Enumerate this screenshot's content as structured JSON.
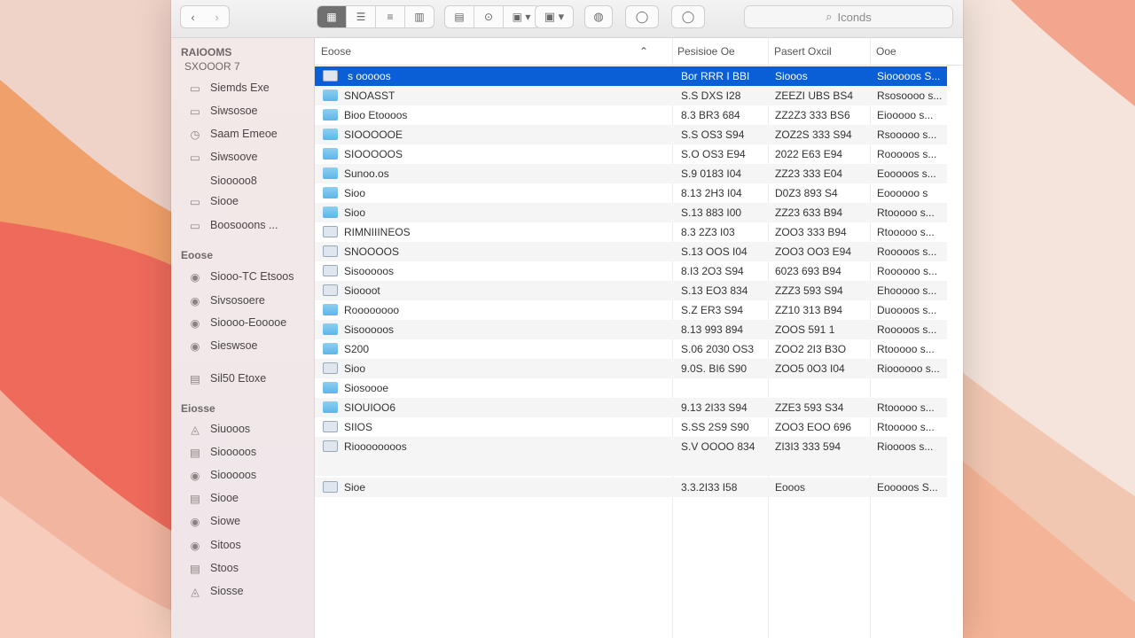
{
  "colors": {
    "accent": "#0a5fd6",
    "folder": "#5cb6e8",
    "wallpaper_orange": "#f0874e",
    "wallpaper_red": "#ee5a57"
  },
  "toolbar": {
    "search_placeholder": "Iconds",
    "icons": [
      "back-icon",
      "forward-icon",
      "grid-view-icon",
      "list-view-icon",
      "column-view-icon",
      "gallery-view-icon",
      "group-icon",
      "share-icon",
      "tag-icon",
      "action-icon",
      "airdrop-icon",
      "search-icon"
    ]
  },
  "sidebar": {
    "section1": {
      "title": "RAIOOMS",
      "subtitle": "SXOOOR 7"
    },
    "group1": [
      {
        "label": "Siemds Exe",
        "icon": "folder-icon"
      },
      {
        "label": "Siwsosoe",
        "icon": "folder-icon"
      },
      {
        "label": "Saam Emeoe",
        "icon": "clock-icon"
      },
      {
        "label": "Siwsoove",
        "icon": "folder-icon"
      },
      {
        "label": "Siooooo8",
        "icon": ""
      },
      {
        "label": "Siooe",
        "icon": "folder-icon"
      },
      {
        "label": "Boosooons ...",
        "icon": "folder-icon"
      }
    ],
    "section2": {
      "title": "Eoose"
    },
    "group2": [
      {
        "label": "Siooo-TC Etsoos",
        "icon": "disk-icon"
      },
      {
        "label": "Sivsosoere",
        "icon": "disk-icon"
      },
      {
        "label": "Sioooo-Eooooe",
        "icon": "disk-icon"
      },
      {
        "label": "Sieswsoe",
        "icon": "disk-icon"
      },
      {
        "label": "Sil50 Etoxe",
        "icon": "drive-icon"
      }
    ],
    "section3": {
      "title": "Eiosse"
    },
    "group3": [
      {
        "label": "Siuooos",
        "icon": "tag-icon"
      },
      {
        "label": "Siooooos",
        "icon": "drive-icon"
      },
      {
        "label": "Siooooos",
        "icon": "disk-icon"
      },
      {
        "label": "Siooe",
        "icon": "drive-icon"
      },
      {
        "label": "Siowe",
        "icon": "disk-icon"
      },
      {
        "label": "Sitoos",
        "icon": "disk-icon"
      },
      {
        "label": "Stoos",
        "icon": "drive-icon"
      },
      {
        "label": "Siosse",
        "icon": "tag-icon"
      }
    ]
  },
  "columns": {
    "name": "Eoose",
    "sort_indicator": "⌃",
    "modified": "Pesisioe Oe",
    "size": "Pasert Oxcil",
    "kind": "Ooe"
  },
  "files": [
    {
      "name": "s ooooos",
      "modified": "Bor RRR I BBI",
      "size": "Siooos",
      "kind": "Siooooos S...",
      "type": "file",
      "selected": true
    },
    {
      "name": "SNOASST",
      "modified": "S.S DXS I28",
      "size": "ZEEZI UBS BS4",
      "kind": "Rsosoooo s...",
      "type": "folder"
    },
    {
      "name": "Bioo Etoooos",
      "modified": "8.3 BR3 684",
      "size": "ZZ2Z3 333 BS6",
      "kind": "Eiooooo s...",
      "type": "folder"
    },
    {
      "name": "SIOOOOOE",
      "modified": "S.S OS3 S94",
      "size": "ZOZ2S 333 S94",
      "kind": "Rsooooo s...",
      "type": "folder"
    },
    {
      "name": "SIOOOOOS",
      "modified": "S.O OS3 E94",
      "size": "2022 E63 E94",
      "kind": "Rooooos s...",
      "type": "folder"
    },
    {
      "name": "Sunoo.os",
      "modified": "S.9 0183 I04",
      "size": "ZZ23 333 E04",
      "kind": "Eooooos s...",
      "type": "folder"
    },
    {
      "name": "Sioo",
      "modified": "8.13 2H3 I04",
      "size": "D0Z3 893 S4",
      "kind": "Eoooooo s",
      "type": "folder"
    },
    {
      "name": "Sioo",
      "modified": "S.13 883 I00",
      "size": "ZZ23 633 B94",
      "kind": "Rtooooo s...",
      "type": "folder"
    },
    {
      "name": "RIMNIIINEOS",
      "modified": "8.3 2Z3 I03",
      "size": "ZOO3 333 B94",
      "kind": "Rtooooo s...",
      "type": "file"
    },
    {
      "name": "SNOOOOS",
      "modified": "S.13 OOS I04",
      "size": "ZOO3 OO3 E94",
      "kind": "Rooooos s...",
      "type": "file"
    },
    {
      "name": "Sisooooos",
      "modified": "8.I3 2O3 S94",
      "size": "6023 693 B94",
      "kind": "Roooooo s...",
      "type": "file"
    },
    {
      "name": "Sioooot",
      "modified": "S.13 EO3 834",
      "size": "ZZZ3 593 S94",
      "kind": "Ehooooo s...",
      "type": "file"
    },
    {
      "name": "Roooooooo",
      "modified": "S.Z ER3 S94",
      "size": "ZZ10 313 B94",
      "kind": "Duoooos s...",
      "type": "folder"
    },
    {
      "name": "Sisooooos",
      "modified": "8.13 993 894",
      "size": "ZOOS 591 1",
      "kind": "Rooooos s...",
      "type": "folder"
    },
    {
      "name": "S200",
      "modified": "S.06 2030 OS3",
      "size": "ZOO2 2I3 B3O",
      "kind": "Rtooooo s...",
      "type": "folder"
    },
    {
      "name": "Sioo",
      "modified": "9.0S. BI6 S90",
      "size": "ZOO5 0O3 I04",
      "kind": "Rioooooo s...",
      "type": "file"
    },
    {
      "name": "Siosoooe",
      "modified": "",
      "size": "",
      "kind": "",
      "type": "folder"
    },
    {
      "name": "SIOUIOO6",
      "modified": "9.13 2I33 S94",
      "size": "ZZE3 593 S34",
      "kind": "Rtooooo s...",
      "type": "folder"
    },
    {
      "name": "SIIOS",
      "modified": "S.SS 2S9 S90",
      "size": "ZOO3 EOO 696",
      "kind": "Rtooooo s...",
      "type": "file"
    },
    {
      "name": "Rioooooooos",
      "modified": "S.V OOOO 834",
      "size": "ZI3I3 333 594",
      "kind": "Rioooos s...",
      "type": "file"
    },
    {
      "name": "",
      "modified": "",
      "size": "",
      "kind": "",
      "type": "blank"
    },
    {
      "name": "Sioe",
      "modified": "3.3.2I33 I58",
      "size": "Eooos",
      "kind": "Eooooos S...",
      "type": "lock"
    }
  ]
}
